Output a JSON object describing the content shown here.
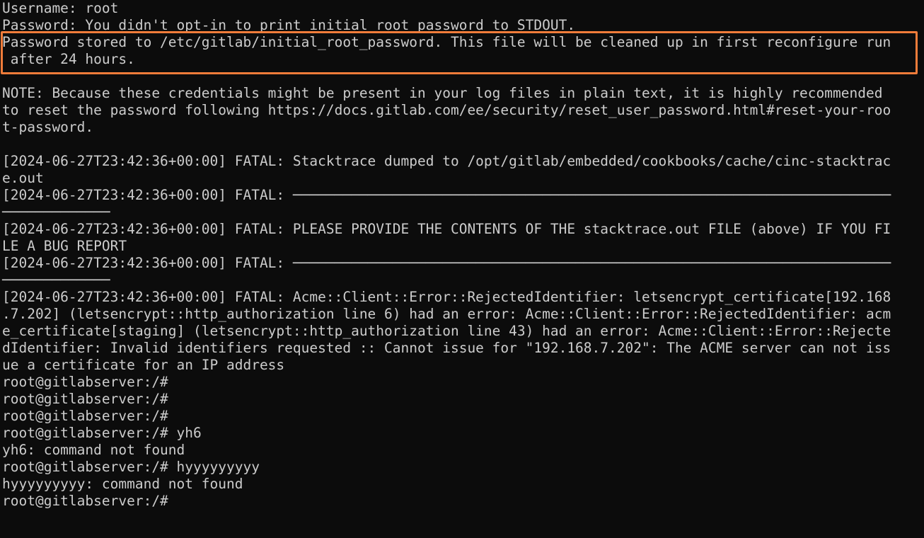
{
  "terminal": {
    "lines": [
      "Username: root",
      "Password: You didn't opt-in to print initial root password to STDOUT.",
      "Password stored to /etc/gitlab/initial_root_password. This file will be cleaned up in first reconfigure run",
      " after 24 hours.",
      "",
      "NOTE: Because these credentials might be present in your log files in plain text, it is highly recommended",
      "to reset the password following https://docs.gitlab.com/ee/security/reset_user_password.html#reset-your-roo",
      "t-password.",
      "",
      "[2024-06-27T23:42:36+00:00] FATAL: Stacktrace dumped to /opt/gitlab/embedded/cookbooks/cache/cinc-stacktrac",
      "e.out",
      "[2024-06-27T23:42:36+00:00] FATAL: ────────────────────────────────────────────────────────────────────────",
      "─────────────",
      "[2024-06-27T23:42:36+00:00] FATAL: PLEASE PROVIDE THE CONTENTS OF THE stacktrace.out FILE (above) IF YOU FI",
      "LE A BUG REPORT",
      "[2024-06-27T23:42:36+00:00] FATAL: ────────────────────────────────────────────────────────────────────────",
      "─────────────",
      "[2024-06-27T23:42:36+00:00] FATAL: Acme::Client::Error::RejectedIdentifier: letsencrypt_certificate[192.168",
      ".7.202] (letsencrypt::http_authorization line 6) had an error: Acme::Client::Error::RejectedIdentifier: acm",
      "e_certificate[staging] (letsencrypt::http_authorization line 43) had an error: Acme::Client::Error::Rejecte",
      "dIdentifier: Invalid identifiers requested :: Cannot issue for \"192.168.7.202\": The ACME server can not iss",
      "ue a certificate for an IP address",
      "root@gitlabserver:/#",
      "root@gitlabserver:/#",
      "root@gitlabserver:/#",
      "root@gitlabserver:/# yh6",
      "yh6: command not found",
      "root@gitlabserver:/# hyyyyyyyyy",
      "hyyyyyyyyy: command not found",
      "root@gitlabserver:/#"
    ]
  },
  "colors": {
    "background": "#0c0c0c",
    "text": "#cccccc",
    "highlight": "#f07c3a"
  }
}
